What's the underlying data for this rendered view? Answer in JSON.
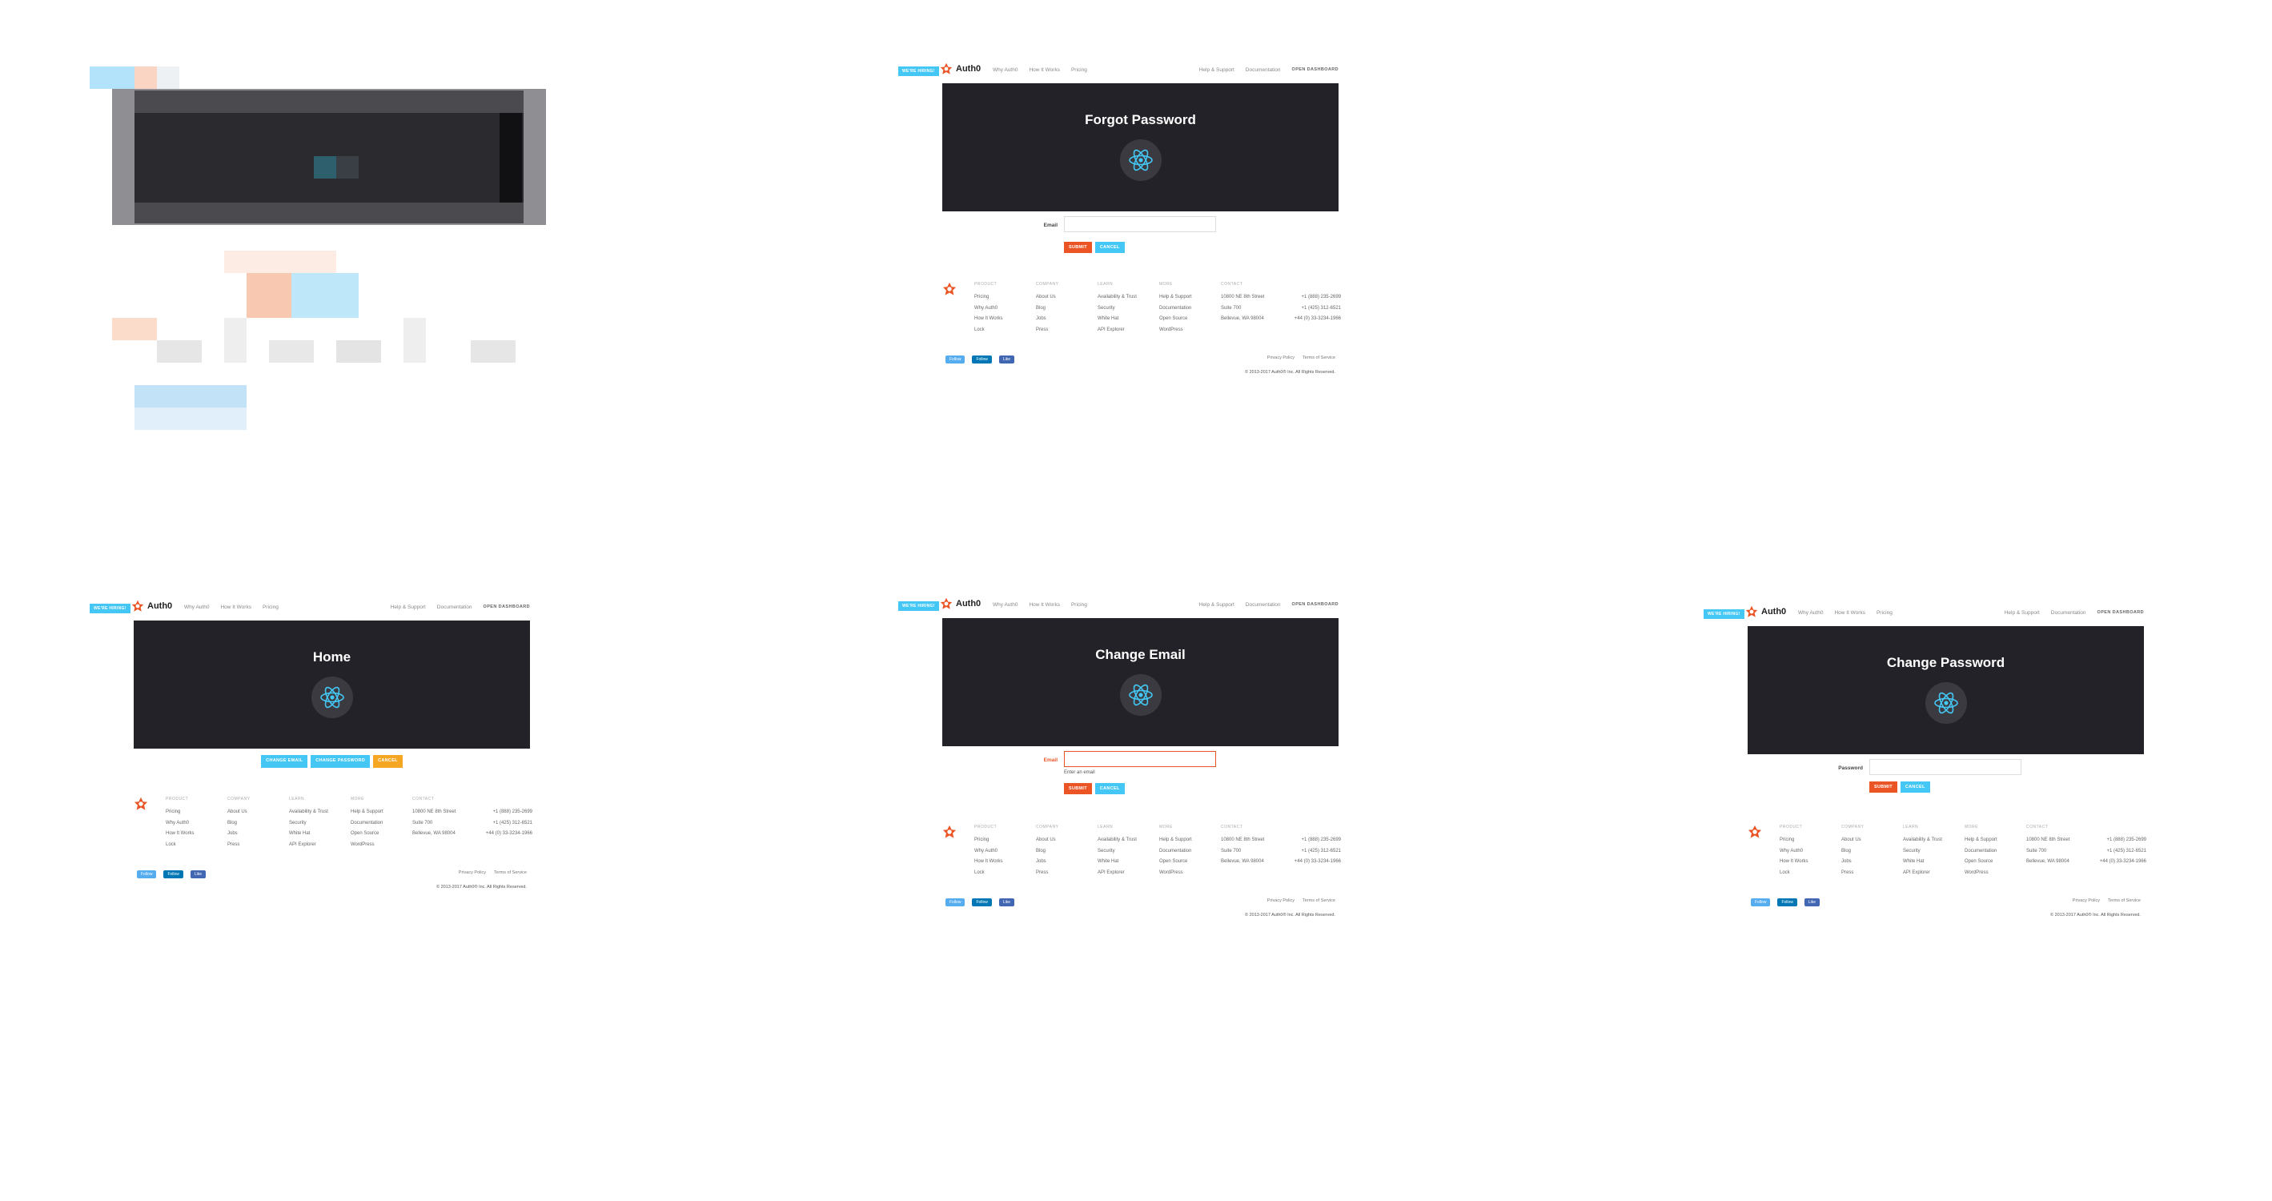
{
  "nav": {
    "badge": "WE'RE HIRING!",
    "logo_text": "Auth0",
    "links": [
      "Why Auth0",
      "How It Works",
      "Pricing"
    ],
    "right_links": [
      "Help & Support",
      "Documentation"
    ],
    "dashboard": "OPEN DASHBOARD"
  },
  "screens": {
    "forgot": {
      "title": "Forgot Password",
      "field_label": "Email"
    },
    "home": {
      "title": "Home",
      "buttons": [
        "CHANGE EMAIL",
        "CHANGE PASSWORD",
        "CANCEL"
      ]
    },
    "change_email": {
      "title": "Change Email",
      "field_label": "Email",
      "help": "Enter an email"
    },
    "change_password": {
      "title": "Change Password",
      "field_label": "Password"
    }
  },
  "buttons": {
    "submit": "SUBMIT",
    "cancel": "CANCEL"
  },
  "footer": {
    "columns": [
      {
        "head": "PRODUCT",
        "items": [
          "Pricing",
          "Why Auth0",
          "How It Works",
          "Lock"
        ]
      },
      {
        "head": "COMPANY",
        "items": [
          "About Us",
          "Blog",
          "Jobs",
          "Press"
        ]
      },
      {
        "head": "LEARN",
        "items": [
          "Availability & Trust",
          "Security",
          "White Hat",
          "API Explorer"
        ]
      },
      {
        "head": "MORE",
        "items": [
          "Help & Support",
          "Documentation",
          "Open Source",
          "WordPress"
        ]
      }
    ],
    "contact_head": "CONTACT",
    "contact_rows": [
      [
        "10800 NE 8th Street",
        "+1 (888) 235-2699"
      ],
      [
        "Suite 700",
        "+1 (425) 312-6521"
      ],
      [
        "Bellevue, WA 98004",
        "+44 (0) 33-3234-1966"
      ]
    ],
    "social": [
      "Follow",
      "Follow",
      "Like"
    ],
    "legal": [
      "Privacy Policy",
      "Terms of Service"
    ],
    "copyright": "© 2013-2017 Auth0® Inc. All Rights Reserved."
  },
  "colors": {
    "brand_orange": "#eb5424",
    "accent_blue": "#44c7f4",
    "hero_dark": "#222228",
    "warn": "#f5a623"
  },
  "icons": [
    "auth0-logo-icon",
    "react-atom-icon",
    "auth0-footer-icon"
  ]
}
